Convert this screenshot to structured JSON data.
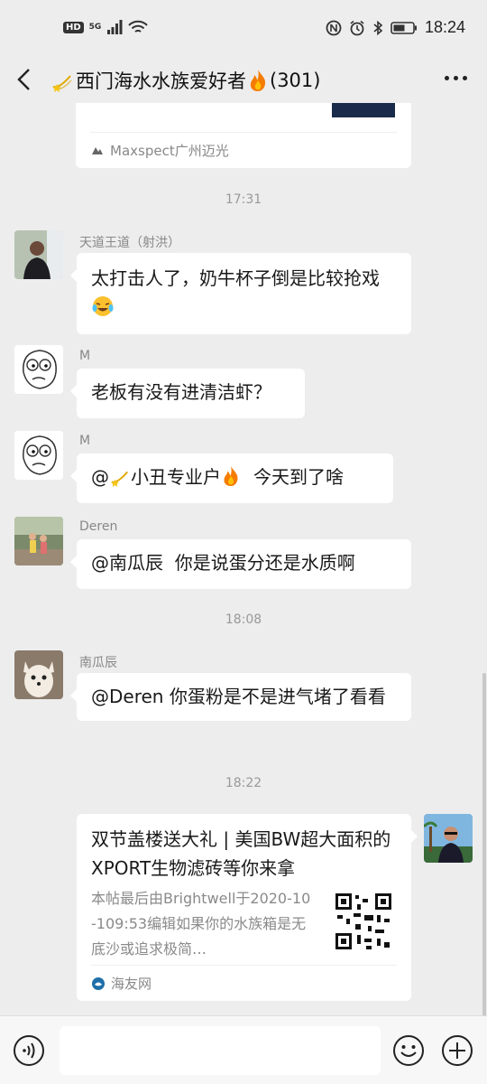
{
  "status_bar": {
    "time": "18:24",
    "hd": "HD",
    "network": "5G"
  },
  "header": {
    "title": "西门海水水族爱好者",
    "count": "(301)"
  },
  "messages": {
    "link1_source": "Maxspect广州迈光",
    "time1": "17:31",
    "m1": {
      "sender": "天道王道（射洪）",
      "text": "太打击人了，奶牛杯子倒是比较抢戏"
    },
    "m2": {
      "sender": "M",
      "text": "老板有没有进清洁虾？"
    },
    "m3": {
      "sender": "M",
      "mention": "@",
      "mention_name": "小丑专业户",
      "text": "今天到了啥"
    },
    "m4": {
      "sender": "Deren",
      "text": "@南瓜辰  你是说蛋分还是水质啊"
    },
    "time2": "18:08",
    "m5": {
      "sender": "南瓜辰",
      "text": "@Deren 你蛋粉是不是进气堵了看看"
    },
    "time3": "18:22",
    "link2": {
      "title": "双节盖楼送大礼 | 美国BW超大面积的XPORT生物滤砖等你来拿",
      "desc": "本帖最后由Brightwell于2020-10-109:53编辑如果你的水族箱是无底沙或追求极简…",
      "source": "海友网"
    }
  },
  "icons": {
    "back": "back-arrow-icon",
    "more": "more-dots-icon",
    "voice": "voice-icon",
    "emoji": "emoji-icon",
    "plus": "plus-icon"
  },
  "colors": {
    "background": "#ededed",
    "bubble": "#ffffff",
    "meta_text": "#888888"
  }
}
